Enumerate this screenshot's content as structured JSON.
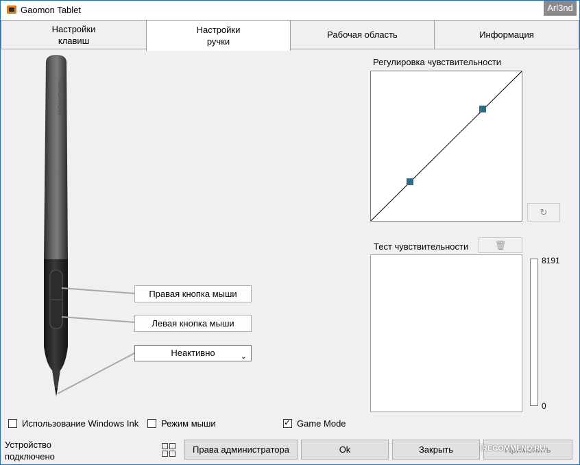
{
  "window": {
    "title": "Gaomon Tablet",
    "corner_watermark": "Arl3nd"
  },
  "tabs": [
    {
      "label": "Настройки\nклавиш",
      "active": false
    },
    {
      "label": "Настройки\nручки",
      "active": true
    },
    {
      "label": "Рабочая область",
      "active": false
    },
    {
      "label": "Информация",
      "active": false
    }
  ],
  "pen": {
    "right_button": "Правая кнопка мыши",
    "left_button": "Левая кнопка мыши",
    "tip_select": "Неактивно"
  },
  "sensitivity": {
    "title": "Регулировка чувствительности",
    "test_title": "Тест чувствительности",
    "max_label": "8191",
    "min_label": "0",
    "point_color": "#2f6d87"
  },
  "options": {
    "windows_ink": {
      "label": "Использование Windows Ink",
      "checked": false
    },
    "mouse_mode": {
      "label": "Режим мыши",
      "checked": false
    },
    "game_mode": {
      "label": "Game Mode",
      "checked": true
    }
  },
  "status": {
    "text": "Устройство\nподключено"
  },
  "footer": {
    "admin_label": "Права администратора",
    "ok_label": "Ok",
    "close_label": "Закрыть",
    "apply_label": "Применить",
    "watermark": "IRECOMMEND.RU"
  }
}
